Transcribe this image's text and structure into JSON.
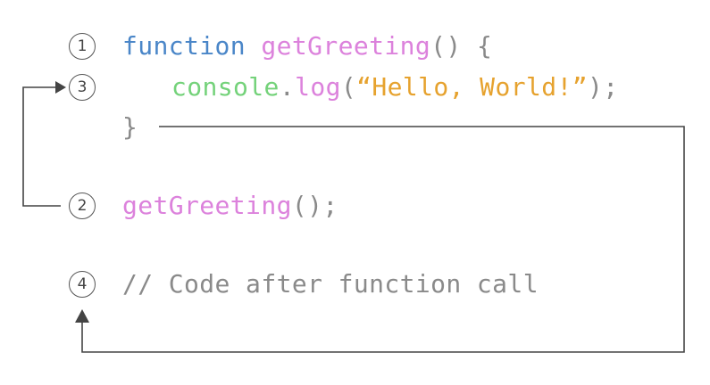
{
  "steps": [
    {
      "number": "1"
    },
    {
      "number": "3"
    },
    {
      "number": "2"
    },
    {
      "number": "4"
    }
  ],
  "code": {
    "line1": {
      "keyword": "function",
      "name": "getGreeting",
      "rest": "() {"
    },
    "line2": {
      "object": "console",
      "dot": ".",
      "method": "log",
      "open": "(",
      "string": "“Hello, World!”",
      "close": ");"
    },
    "line3": {
      "brace": "}"
    },
    "line4": {
      "name": "getGreeting",
      "rest": "();"
    },
    "line5": {
      "comment": "// Code after function call"
    }
  },
  "colors": {
    "keyword": "#4a86c8",
    "function_name": "#dc82dc",
    "punctuation": "#8a8a8a",
    "object": "#74d27a",
    "string": "#e6a22e",
    "comment": "#8a8a8a",
    "arrow": "#444444"
  }
}
